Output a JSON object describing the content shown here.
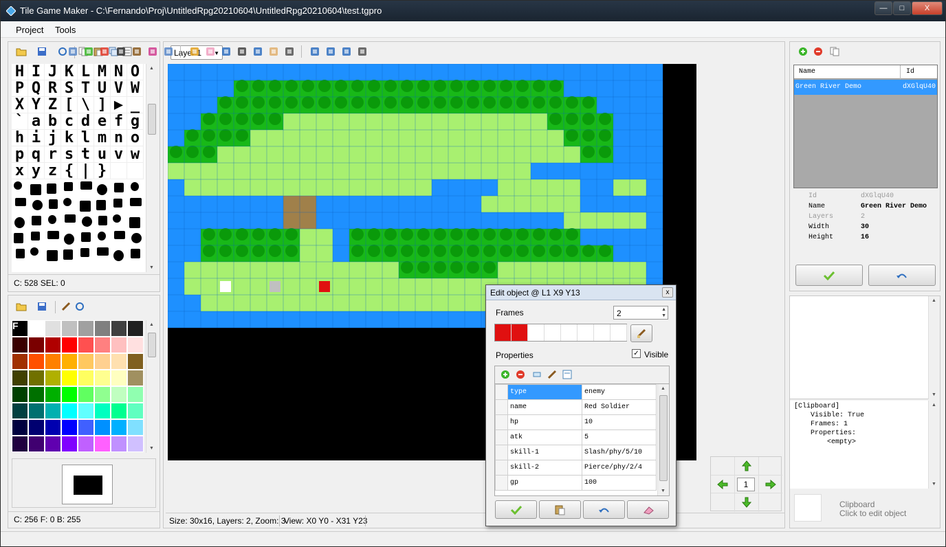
{
  "window": {
    "title": "Tile Game Maker - C:\\Fernando\\Proj\\UntitledRpg20210604\\UntitledRpg20210604\\test.tgpro",
    "min_glyph": "—",
    "max_glyph": "□",
    "close_glyph": "X"
  },
  "menu": {
    "items": [
      "Project",
      "Tools"
    ]
  },
  "tileset": {
    "ascii_rows": [
      "HIJKLMNO",
      "PQRSTUVW",
      "XYZ[\\]▶_",
      "`abcdefg",
      "hijklmno",
      "pqrstuvw",
      "xyz{|}  "
    ],
    "status": "C: 528 SEL: 0"
  },
  "palette": {
    "status": "C: 256 F: 0 B: 255",
    "rows": [
      [
        "#000000",
        "#ffffff",
        "#e0e0e0",
        "#c0c0c0",
        "#a0a0a0",
        "#808080",
        "#404040",
        "#202020"
      ],
      [
        "#3a0000",
        "#7a0000",
        "#b00000",
        "#ff0000",
        "#ff5050",
        "#ff8080",
        "#ffc0c0",
        "#ffe0e0"
      ],
      [
        "#a03000",
        "#ff5000",
        "#ff8000",
        "#ffb000",
        "#ffc860",
        "#ffd090",
        "#ffe0b0",
        "#806020"
      ],
      [
        "#404000",
        "#707000",
        "#b0b000",
        "#ffff00",
        "#ffff60",
        "#ffff90",
        "#ffffc0",
        "#a09060"
      ],
      [
        "#004000",
        "#007000",
        "#00b000",
        "#00ff00",
        "#60ff60",
        "#90ff90",
        "#c0ffc0",
        "#90ffb0"
      ],
      [
        "#004040",
        "#007070",
        "#00b0b0",
        "#00ffff",
        "#60ffff",
        "#00ffc0",
        "#00ff90",
        "#60ffc0"
      ],
      [
        "#000040",
        "#000070",
        "#0000b0",
        "#0000ff",
        "#4060ff",
        "#0090ff",
        "#00b0ff",
        "#80e0ff"
      ],
      [
        "#200040",
        "#400070",
        "#6000b0",
        "#8000ff",
        "#c060ff",
        "#ff60ff",
        "#c090ff",
        "#d0c0ff"
      ]
    ]
  },
  "editor": {
    "layer_select": "Layer 1",
    "status_size": "Size: 30x16, Layers: 2, Zoom: 3",
    "status_view": "View: X0 Y0 - X31 Y23"
  },
  "nav": {
    "value": "1"
  },
  "maps": {
    "col_name": "Name",
    "col_id": "Id",
    "rows": [
      {
        "name": "Green River Demo",
        "id": "dXGlqU40"
      }
    ]
  },
  "props": {
    "rows": [
      {
        "label": "Id",
        "value": "dXGlqU40"
      },
      {
        "label": "Name",
        "value": "Green River Demo"
      },
      {
        "label": "Layers",
        "value": "2"
      },
      {
        "label": "Width",
        "value": "30"
      },
      {
        "label": "Height",
        "value": "16"
      }
    ]
  },
  "clipboard": {
    "text": "[Clipboard]\n    Visible: True\n    Frames: 1\n    Properties:\n        <empty>",
    "title": "Clipboard",
    "subtitle": "Click to edit object"
  },
  "dialog": {
    "title": "Edit object @ L1 X9 Y13",
    "close_glyph": "x",
    "frames_label": "Frames",
    "frames_value": "2",
    "properties_label": "Properties",
    "visible_label": "Visible",
    "visible_checked": true,
    "rows": [
      {
        "key": "type",
        "value": "enemy"
      },
      {
        "key": "name",
        "value": "Red Soldier"
      },
      {
        "key": "hp",
        "value": "10"
      },
      {
        "key": "atk",
        "value": "5"
      },
      {
        "key": "skill-1",
        "value": "Slash/phy/5/10"
      },
      {
        "key": "skill-2",
        "value": "Pierce/phy/2/4"
      },
      {
        "key": "gp",
        "value": "100"
      }
    ]
  },
  "colors": {
    "water": "#1e90ff",
    "grass": "#a8f070",
    "tree": "#18b818",
    "selection": "#3399ff"
  }
}
